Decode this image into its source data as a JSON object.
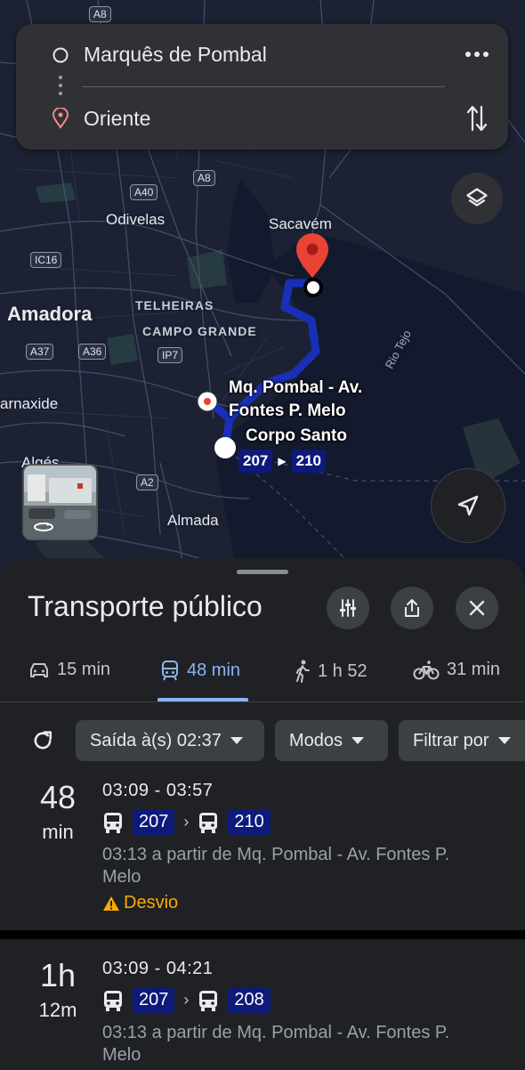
{
  "search": {
    "origin": "Marquês de Pombal",
    "destination": "Oriente"
  },
  "map": {
    "places": {
      "odivelas": "Odivelas",
      "sacavem": "Sacavém",
      "amadora": "Amadora",
      "telheiras": "TELHEIRAS",
      "campo_grande": "CAMPO GRANDE",
      "carnaxide": "arnaxide",
      "alges": "Algés",
      "almada": "Almada",
      "rio_tejo": "Rio Tejo"
    },
    "roads": {
      "a8_top": "A8",
      "a40": "A40",
      "a8": "A8",
      "ic16": "IC16",
      "a37": "A37",
      "a36": "A36",
      "ip7": "IP7",
      "a2": "A2"
    },
    "stops": {
      "start_line1": "Mq. Pombal - Av.",
      "start_line2": "Fontes P. Melo",
      "transfer": "Corpo Santo"
    },
    "route_chip": [
      "207",
      "210"
    ],
    "route_color": "#1a2fb8"
  },
  "sheet": {
    "title": "Transporte público",
    "modes": [
      {
        "icon": "car-icon",
        "label": "15 min"
      },
      {
        "icon": "train-icon",
        "label": "48 min"
      },
      {
        "icon": "walk-icon",
        "label": "1 h 52"
      },
      {
        "icon": "bike-icon",
        "label": "31 min"
      }
    ],
    "filters": {
      "departure": "Saída à(s) 02:37",
      "modes": "Modos",
      "filter": "Filtrar por"
    },
    "results": [
      {
        "dur_big": "48",
        "dur_small": "min",
        "times": "03:09 - 03:57",
        "legs": [
          "207",
          "210"
        ],
        "chevron": "›",
        "detail": "03:13 a partir de Mq. Pombal - Av. Fontes P. Melo",
        "warning": "Desvio"
      },
      {
        "dur_big": "1h",
        "dur_small": "12m",
        "times": "03:09 - 04:21",
        "legs": [
          "207",
          "208"
        ],
        "chevron": "›",
        "detail": "03:13 a partir de Mq. Pombal - Av. Fontes P. Melo"
      }
    ]
  },
  "colors": {
    "accent": "#8ab4f8",
    "bus_badge": "#0d1a7a",
    "warning": "#f9ab00",
    "pin": "#ea4335"
  }
}
